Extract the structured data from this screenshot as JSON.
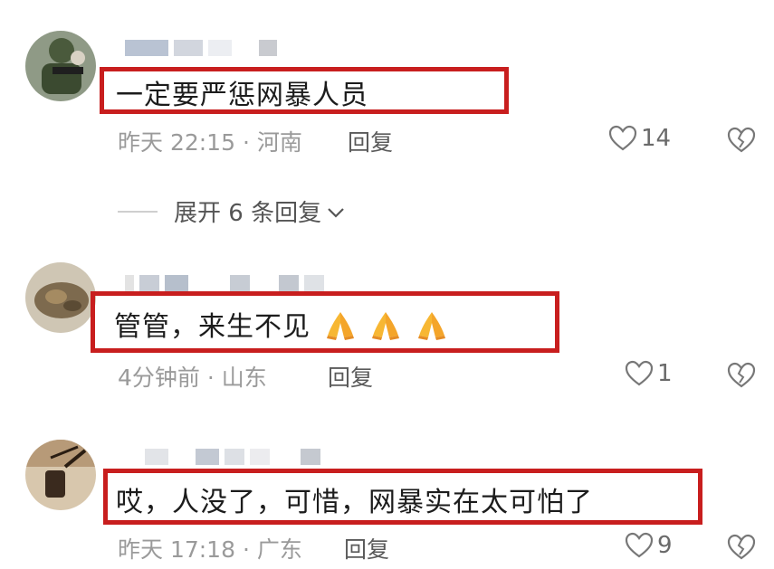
{
  "comments": [
    {
      "text": "一定要严惩网暴人员",
      "meta": "昨天 22:15 · 河南",
      "reply_label": "回复",
      "likes": "14"
    },
    {
      "text": "管管，来生不见",
      "meta": "4分钟前 · 山东",
      "reply_label": "回复",
      "likes": "1"
    },
    {
      "text": "哎，人没了，可惜，网暴实在太可怕了",
      "meta": "昨天 17:18 · 广东",
      "reply_label": "回复",
      "likes": "9"
    }
  ],
  "expand_replies": "展开 6 条回复",
  "colors": {
    "highlight": "#c81e1e",
    "meta": "#9a9a9a"
  },
  "icons": [
    "heart-icon",
    "broken-heart-icon",
    "chevron-down-icon",
    "folded-hands-emoji"
  ]
}
